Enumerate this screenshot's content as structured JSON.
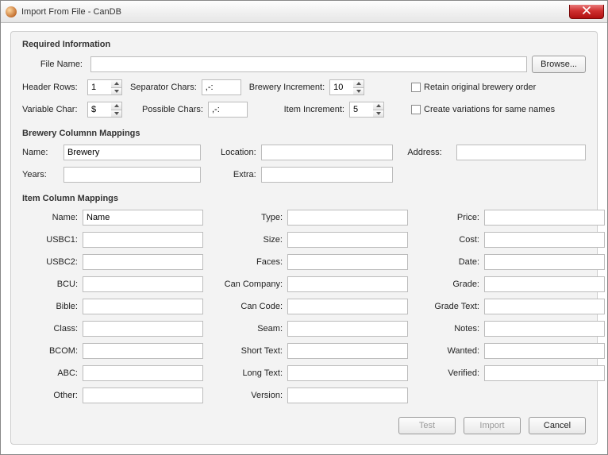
{
  "window": {
    "title": "Import From File - CanDB"
  },
  "required": {
    "section_title": "Required Information",
    "file_label": "File Name:",
    "file_value": "",
    "browse_label": "Browse...",
    "header_rows_label": "Header Rows:",
    "header_rows_value": "1",
    "separator_chars_label": "Separator Chars:",
    "separator_chars_value": ",-:",
    "brewery_increment_label": "Brewery Increment:",
    "brewery_increment_value": "10",
    "retain_order_label": "Retain original brewery order",
    "variable_char_label": "Variable Char:",
    "variable_char_value": "$",
    "possible_chars_label": "Possible Chars:",
    "possible_chars_value": ",-:",
    "item_increment_label": "Item Increment:",
    "item_increment_value": "5",
    "create_variations_label": "Create variations for same names"
  },
  "brewery": {
    "section_title": "Brewery Columnn Mappings",
    "name_label": "Name:",
    "name_value": "Brewery",
    "location_label": "Location:",
    "location_value": "",
    "address_label": "Address:",
    "address_value": "",
    "years_label": "Years:",
    "years_value": "",
    "extra_label": "Extra:",
    "extra_value": ""
  },
  "item": {
    "section_title": "Item Column Mappings",
    "left": [
      {
        "label": "Name:",
        "value": "Name"
      },
      {
        "label": "USBC1:",
        "value": ""
      },
      {
        "label": "USBC2:",
        "value": ""
      },
      {
        "label": "BCU:",
        "value": ""
      },
      {
        "label": "Bible:",
        "value": ""
      },
      {
        "label": "Class:",
        "value": ""
      },
      {
        "label": "BCOM:",
        "value": ""
      },
      {
        "label": "ABC:",
        "value": ""
      },
      {
        "label": "Other:",
        "value": ""
      }
    ],
    "mid": [
      {
        "label": "Type:",
        "value": ""
      },
      {
        "label": "Size:",
        "value": ""
      },
      {
        "label": "Faces:",
        "value": ""
      },
      {
        "label": "Can Company:",
        "value": ""
      },
      {
        "label": "Can Code:",
        "value": ""
      },
      {
        "label": "Seam:",
        "value": ""
      },
      {
        "label": "Short Text:",
        "value": ""
      },
      {
        "label": "Long Text:",
        "value": ""
      },
      {
        "label": "Version:",
        "value": ""
      }
    ],
    "right": [
      {
        "label": "Price:",
        "value": ""
      },
      {
        "label": "Cost:",
        "value": ""
      },
      {
        "label": "Date:",
        "value": ""
      },
      {
        "label": "Grade:",
        "value": ""
      },
      {
        "label": "Grade Text:",
        "value": ""
      },
      {
        "label": "Notes:",
        "value": ""
      },
      {
        "label": "Wanted:",
        "value": ""
      },
      {
        "label": "Verified:",
        "value": ""
      }
    ]
  },
  "footer": {
    "test_label": "Test",
    "import_label": "Import",
    "cancel_label": "Cancel"
  }
}
